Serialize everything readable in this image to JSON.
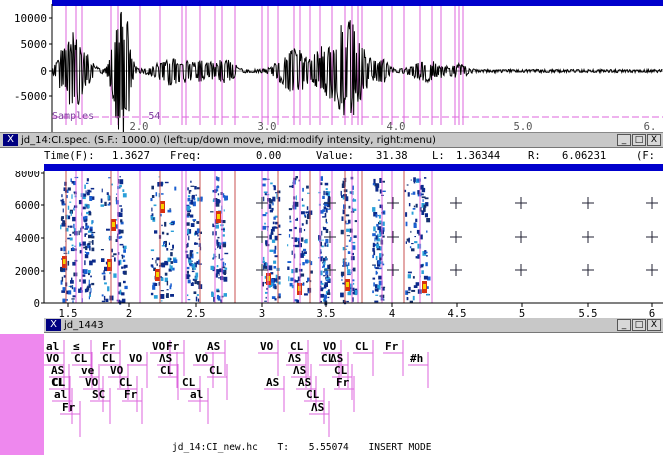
{
  "waveform": {
    "y_ticks": [
      "10000",
      "5000",
      "0",
      "-5000"
    ],
    "x_ticks": [
      "2.0",
      "3.0",
      "4.0",
      "5.0",
      "6."
    ],
    "samples_label": "Samples",
    "samples_value": "54"
  },
  "spectrogram": {
    "title": "jd_14:CI.spec. (S.F.: 1000.0) (left:up/down move, mid:modify intensity, right:menu)",
    "buttons": {
      "minimize": "_",
      "maximize": "□",
      "close": "X"
    },
    "readout": {
      "time_label": "Time(F):",
      "time_value": "1.3627",
      "freq_label": "Freq:",
      "freq_value": "0.00",
      "value_label": "Value:",
      "value_value": "31.38",
      "l_label": "L:",
      "l_value": "1.36344",
      "r_label": "R:",
      "r_value": "6.06231",
      "f_label": "(F:"
    },
    "y_ticks": [
      "8000",
      "6000",
      "4000",
      "2000",
      "0"
    ],
    "x_ticks": [
      "1.5",
      "2",
      "2.5",
      "3",
      "3.5",
      "4",
      "4.5",
      "5",
      "5.5",
      "6"
    ]
  },
  "label_window": {
    "title": "jd_1443",
    "buttons": {
      "minimize": "_",
      "maximize": "□",
      "close": "X"
    },
    "tiers": [
      {
        "text": "al",
        "col": 0,
        "row": 0
      },
      {
        "text": "≤",
        "col": 1,
        "row": 0
      },
      {
        "text": "Fr",
        "col": 2,
        "row": 0
      },
      {
        "text": "VO",
        "col": 3,
        "row": 0
      },
      {
        "text": "Fr",
        "col": 4,
        "row": 0
      },
      {
        "text": "AS",
        "col": 5,
        "row": 0
      },
      {
        "text": "VO",
        "col": 6,
        "row": 0
      },
      {
        "text": "CL",
        "col": 7,
        "row": 0
      },
      {
        "text": "VO",
        "col": 8,
        "row": 0
      },
      {
        "text": "CL",
        "col": 9,
        "row": 0
      },
      {
        "text": "Fr",
        "col": 10,
        "row": 0
      },
      {
        "text": "#h",
        "col": 11,
        "row": 1
      },
      {
        "text": "VO",
        "col": 12,
        "row": 1
      },
      {
        "text": "CL",
        "col": 13,
        "row": 1
      },
      {
        "text": "CL",
        "col": 14,
        "row": 1
      },
      {
        "text": "VO",
        "col": 15,
        "row": 1
      },
      {
        "text": "ΛS",
        "col": 16,
        "row": 1
      },
      {
        "text": "VO",
        "col": 17,
        "row": 1
      },
      {
        "text": "ΛS",
        "col": 18,
        "row": 1
      },
      {
        "text": "CL",
        "col": 19,
        "row": 1
      },
      {
        "text": "ΛS",
        "col": 20,
        "row": 1
      },
      {
        "text": "AS",
        "col": 21,
        "row": 2
      },
      {
        "text": "ve",
        "col": 22,
        "row": 2
      },
      {
        "text": "VO",
        "col": 23,
        "row": 2
      },
      {
        "text": "CL",
        "col": 24,
        "row": 2
      },
      {
        "text": "CL",
        "col": 25,
        "row": 2
      },
      {
        "text": "ΛS",
        "col": 26,
        "row": 2
      },
      {
        "text": "CL",
        "col": 27,
        "row": 2
      },
      {
        "text": "CL",
        "col": 28,
        "row": 2
      },
      {
        "text": "CL",
        "col": 29,
        "row": 3
      },
      {
        "text": "VO",
        "col": 30,
        "row": 3
      },
      {
        "text": "CL",
        "col": 31,
        "row": 3
      },
      {
        "text": "CL",
        "col": 32,
        "row": 3
      },
      {
        "text": "AS",
        "col": 33,
        "row": 3
      },
      {
        "text": "AS",
        "col": 34,
        "row": 3
      },
      {
        "text": "Fr",
        "col": 35,
        "row": 3
      },
      {
        "text": "al",
        "col": 36,
        "row": 4
      },
      {
        "text": "SC",
        "col": 37,
        "row": 4
      },
      {
        "text": "Fr",
        "col": 38,
        "row": 4
      },
      {
        "text": "al",
        "col": 39,
        "row": 4
      },
      {
        "text": "CL",
        "col": 40,
        "row": 4
      },
      {
        "text": "Fr",
        "col": 41,
        "row": 5
      },
      {
        "text": "ΛS",
        "col": 42,
        "row": 5
      }
    ],
    "status": {
      "file": "jd_14:CI_new.hc",
      "time_label": "T:",
      "time_value": "5.55074",
      "mode": "INSERT MODE"
    }
  },
  "colors": {
    "accent_blue": "#0000cc",
    "marker_magenta": "#dd66dd",
    "sidebar_pink": "#ee88ee",
    "titlebar_gray": "#c8c8c8"
  }
}
